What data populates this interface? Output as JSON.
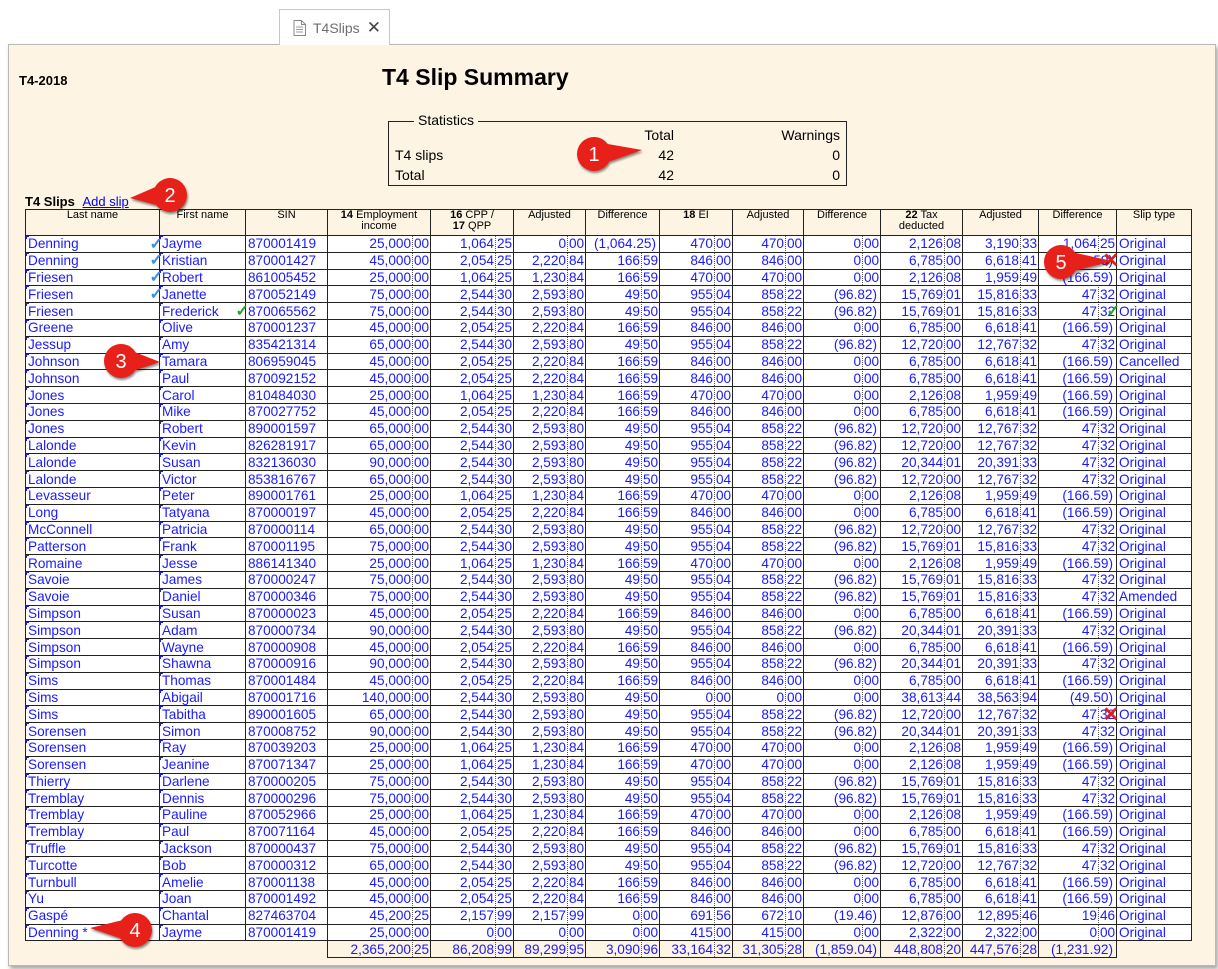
{
  "tab": {
    "label": "T4Slips",
    "close": "✕",
    "icon": "document-icon"
  },
  "year": "T4-2018",
  "title": "T4 Slip Summary",
  "stats": {
    "legend": "Statistics",
    "headers": [
      "",
      "Total",
      "Warnings"
    ],
    "rows": [
      [
        "T4 slips",
        "42",
        "0"
      ],
      [
        "Total",
        "42",
        "0"
      ]
    ]
  },
  "slips_heading": "T4 Slips",
  "add_slip": "Add slip",
  "columns": [
    {
      "label": "Last name"
    },
    {
      "label": "First name"
    },
    {
      "label": "SIN"
    },
    {
      "num": "14",
      "label": "Employment income"
    },
    {
      "num": "16",
      "label": "CPP /",
      "num2": "17",
      "label2": "QPP"
    },
    {
      "label": "Adjusted"
    },
    {
      "label": "Difference"
    },
    {
      "num": "18",
      "label": "EI"
    },
    {
      "label": "Adjusted"
    },
    {
      "label": "Difference"
    },
    {
      "num": "22",
      "label": "Tax deducted"
    },
    {
      "label": "Adjusted"
    },
    {
      "label": "Difference"
    },
    {
      "label": "Slip type"
    }
  ],
  "rows": [
    [
      "Denning",
      "Jayme",
      "870001419",
      "25,000.00",
      "1,064.25",
      "0.00",
      "(1,064.25)",
      "470.00",
      "470.00",
      "0.00",
      "2,126.08",
      "3,190.33",
      "1,064.25",
      "Original"
    ],
    [
      "Denning",
      "Kristian",
      "870001427",
      "45,000.00",
      "2,054.25",
      "2,220.84",
      "166.59",
      "846.00",
      "846.00",
      "0.00",
      "6,785.00",
      "6,618.41",
      "(166.59)",
      "Original"
    ],
    [
      "Friesen",
      "Robert",
      "861005452",
      "25,000.00",
      "1,064.25",
      "1,230.84",
      "166.59",
      "470.00",
      "470.00",
      "0.00",
      "2,126.08",
      "1,959.49",
      "(166.59)",
      "Original"
    ],
    [
      "Friesen",
      "Janette",
      "870052149",
      "75,000.00",
      "2,544.30",
      "2,593.80",
      "49.50",
      "955.04",
      "858.22",
      "(96.82)",
      "15,769.01",
      "15,816.33",
      "47.32",
      "Original"
    ],
    [
      "Friesen",
      "Frederick",
      "870065562",
      "75,000.00",
      "2,544.30",
      "2,593.80",
      "49.50",
      "955.04",
      "858.22",
      "(96.82)",
      "15,769.01",
      "15,816.33",
      "47.32",
      "Original"
    ],
    [
      "Greene",
      "Olive",
      "870001237",
      "45,000.00",
      "2,054.25",
      "2,220.84",
      "166.59",
      "846.00",
      "846.00",
      "0.00",
      "6,785.00",
      "6,618.41",
      "(166.59)",
      "Original"
    ],
    [
      "Jessup",
      "Amy",
      "835421314",
      "65,000.00",
      "2,544.30",
      "2,593.80",
      "49.50",
      "955.04",
      "858.22",
      "(96.82)",
      "12,720.00",
      "12,767.32",
      "47.32",
      "Original"
    ],
    [
      "Johnson",
      "Tamara",
      "806959045",
      "45,000.00",
      "2,054.25",
      "2,220.84",
      "166.59",
      "846.00",
      "846.00",
      "0.00",
      "6,785.00",
      "6,618.41",
      "(166.59)",
      "Cancelled"
    ],
    [
      "Johnson",
      "Paul",
      "870092152",
      "45,000.00",
      "2,054.25",
      "2,220.84",
      "166.59",
      "846.00",
      "846.00",
      "0.00",
      "6,785.00",
      "6,618.41",
      "(166.59)",
      "Original"
    ],
    [
      "Jones",
      "Carol",
      "810484030",
      "25,000.00",
      "1,064.25",
      "1,230.84",
      "166.59",
      "470.00",
      "470.00",
      "0.00",
      "2,126.08",
      "1,959.49",
      "(166.59)",
      "Original"
    ],
    [
      "Jones",
      "Mike",
      "870027752",
      "45,000.00",
      "2,054.25",
      "2,220.84",
      "166.59",
      "846.00",
      "846.00",
      "0.00",
      "6,785.00",
      "6,618.41",
      "(166.59)",
      "Original"
    ],
    [
      "Jones",
      "Robert",
      "890001597",
      "65,000.00",
      "2,544.30",
      "2,593.80",
      "49.50",
      "955.04",
      "858.22",
      "(96.82)",
      "12,720.00",
      "12,767.32",
      "47.32",
      "Original"
    ],
    [
      "Lalonde",
      "Kevin",
      "826281917",
      "65,000.00",
      "2,544.30",
      "2,593.80",
      "49.50",
      "955.04",
      "858.22",
      "(96.82)",
      "12,720.00",
      "12,767.32",
      "47.32",
      "Original"
    ],
    [
      "Lalonde",
      "Susan",
      "832136030",
      "90,000.00",
      "2,544.30",
      "2,593.80",
      "49.50",
      "955.04",
      "858.22",
      "(96.82)",
      "20,344.01",
      "20,391.33",
      "47.32",
      "Original"
    ],
    [
      "Lalonde",
      "Victor",
      "853816767",
      "65,000.00",
      "2,544.30",
      "2,593.80",
      "49.50",
      "955.04",
      "858.22",
      "(96.82)",
      "12,720.00",
      "12,767.32",
      "47.32",
      "Original"
    ],
    [
      "Levasseur",
      "Peter",
      "890001761",
      "25,000.00",
      "1,064.25",
      "1,230.84",
      "166.59",
      "470.00",
      "470.00",
      "0.00",
      "2,126.08",
      "1,959.49",
      "(166.59)",
      "Original"
    ],
    [
      "Long",
      "Tatyana",
      "870000197",
      "45,000.00",
      "2,054.25",
      "2,220.84",
      "166.59",
      "846.00",
      "846.00",
      "0.00",
      "6,785.00",
      "6,618.41",
      "(166.59)",
      "Original"
    ],
    [
      "McConnell",
      "Patricia",
      "870000114",
      "65,000.00",
      "2,544.30",
      "2,593.80",
      "49.50",
      "955.04",
      "858.22",
      "(96.82)",
      "12,720.00",
      "12,767.32",
      "47.32",
      "Original"
    ],
    [
      "Patterson",
      "Frank",
      "870001195",
      "75,000.00",
      "2,544.30",
      "2,593.80",
      "49.50",
      "955.04",
      "858.22",
      "(96.82)",
      "15,769.01",
      "15,816.33",
      "47.32",
      "Original"
    ],
    [
      "Romaine",
      "Jesse",
      "886141340",
      "25,000.00",
      "1,064.25",
      "1,230.84",
      "166.59",
      "470.00",
      "470.00",
      "0.00",
      "2,126.08",
      "1,959.49",
      "(166.59)",
      "Original"
    ],
    [
      "Savoie",
      "James",
      "870000247",
      "75,000.00",
      "2,544.30",
      "2,593.80",
      "49.50",
      "955.04",
      "858.22",
      "(96.82)",
      "15,769.01",
      "15,816.33",
      "47.32",
      "Original"
    ],
    [
      "Savoie",
      "Daniel",
      "870000346",
      "75,000.00",
      "2,544.30",
      "2,593.80",
      "49.50",
      "955.04",
      "858.22",
      "(96.82)",
      "15,769.01",
      "15,816.33",
      "47.32",
      "Amended"
    ],
    [
      "Simpson",
      "Susan",
      "870000023",
      "45,000.00",
      "2,054.25",
      "2,220.84",
      "166.59",
      "846.00",
      "846.00",
      "0.00",
      "6,785.00",
      "6,618.41",
      "(166.59)",
      "Original"
    ],
    [
      "Simpson",
      "Adam",
      "870000734",
      "90,000.00",
      "2,544.30",
      "2,593.80",
      "49.50",
      "955.04",
      "858.22",
      "(96.82)",
      "20,344.01",
      "20,391.33",
      "47.32",
      "Original"
    ],
    [
      "Simpson",
      "Wayne",
      "870000908",
      "45,000.00",
      "2,054.25",
      "2,220.84",
      "166.59",
      "846.00",
      "846.00",
      "0.00",
      "6,785.00",
      "6,618.41",
      "(166.59)",
      "Original"
    ],
    [
      "Simpson",
      "Shawna",
      "870000916",
      "90,000.00",
      "2,544.30",
      "2,593.80",
      "49.50",
      "955.04",
      "858.22",
      "(96.82)",
      "20,344.01",
      "20,391.33",
      "47.32",
      "Original"
    ],
    [
      "Sims",
      "Thomas",
      "870001484",
      "45,000.00",
      "2,054.25",
      "2,220.84",
      "166.59",
      "846.00",
      "846.00",
      "0.00",
      "6,785.00",
      "6,618.41",
      "(166.59)",
      "Original"
    ],
    [
      "Sims",
      "Abigail",
      "870001716",
      "140,000.00",
      "2,544.30",
      "2,593.80",
      "49.50",
      "0.00",
      "0.00",
      "0.00",
      "38,613.44",
      "38,563.94",
      "(49.50)",
      "Original"
    ],
    [
      "Sims",
      "Tabitha",
      "890001605",
      "65,000.00",
      "2,544.30",
      "2,593.80",
      "49.50",
      "955.04",
      "858.22",
      "(96.82)",
      "12,720.00",
      "12,767.32",
      "47.32",
      "Original"
    ],
    [
      "Sorensen",
      "Simon",
      "870008752",
      "90,000.00",
      "2,544.30",
      "2,593.80",
      "49.50",
      "955.04",
      "858.22",
      "(96.82)",
      "20,344.01",
      "20,391.33",
      "47.32",
      "Original"
    ],
    [
      "Sorensen",
      "Ray",
      "870039203",
      "25,000.00",
      "1,064.25",
      "1,230.84",
      "166.59",
      "470.00",
      "470.00",
      "0.00",
      "2,126.08",
      "1,959.49",
      "(166.59)",
      "Original"
    ],
    [
      "Sorensen",
      "Jeanine",
      "870071347",
      "25,000.00",
      "1,064.25",
      "1,230.84",
      "166.59",
      "470.00",
      "470.00",
      "0.00",
      "2,126.08",
      "1,959.49",
      "(166.59)",
      "Original"
    ],
    [
      "Thierry",
      "Darlene",
      "870000205",
      "75,000.00",
      "2,544.30",
      "2,593.80",
      "49.50",
      "955.04",
      "858.22",
      "(96.82)",
      "15,769.01",
      "15,816.33",
      "47.32",
      "Original"
    ],
    [
      "Tremblay",
      "Dennis",
      "870000296",
      "75,000.00",
      "2,544.30",
      "2,593.80",
      "49.50",
      "955.04",
      "858.22",
      "(96.82)",
      "15,769.01",
      "15,816.33",
      "47.32",
      "Original"
    ],
    [
      "Tremblay",
      "Pauline",
      "870052966",
      "25,000.00",
      "1,064.25",
      "1,230.84",
      "166.59",
      "470.00",
      "470.00",
      "0.00",
      "2,126.08",
      "1,959.49",
      "(166.59)",
      "Original"
    ],
    [
      "Tremblay",
      "Paul",
      "870071164",
      "45,000.00",
      "2,054.25",
      "2,220.84",
      "166.59",
      "846.00",
      "846.00",
      "0.00",
      "6,785.00",
      "6,618.41",
      "(166.59)",
      "Original"
    ],
    [
      "Truffle",
      "Jackson",
      "870000437",
      "75,000.00",
      "2,544.30",
      "2,593.80",
      "49.50",
      "955.04",
      "858.22",
      "(96.82)",
      "15,769.01",
      "15,816.33",
      "47.32",
      "Original"
    ],
    [
      "Turcotte",
      "Bob",
      "870000312",
      "65,000.00",
      "2,544.30",
      "2,593.80",
      "49.50",
      "955.04",
      "858.22",
      "(96.82)",
      "12,720.00",
      "12,767.32",
      "47.32",
      "Original"
    ],
    [
      "Turnbull",
      "Amelie",
      "870001138",
      "45,000.00",
      "2,054.25",
      "2,220.84",
      "166.59",
      "846.00",
      "846.00",
      "0.00",
      "6,785.00",
      "6,618.41",
      "(166.59)",
      "Original"
    ],
    [
      "Yu",
      "Joan",
      "870001492",
      "45,000.00",
      "2,054.25",
      "2,220.84",
      "166.59",
      "846.00",
      "846.00",
      "0.00",
      "6,785.00",
      "6,618.41",
      "(166.59)",
      "Original"
    ],
    [
      "Gaspé",
      "Chantal",
      "827463704",
      "45,200.25",
      "2,157.99",
      "2,157.99",
      "0.00",
      "691.56",
      "672.10",
      "(19.46)",
      "12,876.00",
      "12,895.46",
      "19.46",
      "Original"
    ],
    [
      "Denning *",
      "Jayme",
      "870001419",
      "25,000.00",
      "0.00",
      "0.00",
      "0.00",
      "415.00",
      "415.00",
      "0.00",
      "2,322.00",
      "2,322.00",
      "0.00",
      "Original"
    ]
  ],
  "totals": [
    "",
    "",
    "",
    "2,365,200.25",
    "86,208.99",
    "89,299.95",
    "3,090.96",
    "33,164.32",
    "31,305.28",
    "(1,859.04)",
    "448,808.20",
    "447,576.28",
    "(1,231.92)",
    ""
  ],
  "marks": [
    {
      "row": 0,
      "col": 0,
      "type": "check",
      "color": "#3a8ee6"
    },
    {
      "row": 1,
      "col": 0,
      "type": "check",
      "color": "#3a8ee6"
    },
    {
      "row": 2,
      "col": 0,
      "type": "check",
      "color": "#3a8ee6"
    },
    {
      "row": 3,
      "col": 0,
      "type": "check",
      "color": "#3a8ee6"
    },
    {
      "row": 4,
      "col": 1,
      "type": "check",
      "color": "#2aa42a"
    },
    {
      "row": 4,
      "col": 12,
      "type": "check",
      "color": "#2aa42a"
    },
    {
      "row": 1,
      "col": 12,
      "type": "cross",
      "color": "#e0201a"
    },
    {
      "row": 28,
      "col": 12,
      "type": "cross",
      "color": "#e0201a"
    }
  ],
  "callouts": [
    {
      "label": "1",
      "color": "#e8201a"
    },
    {
      "label": "2",
      "color": "#e8201a"
    },
    {
      "label": "3",
      "color": "#e8201a"
    },
    {
      "label": "4",
      "color": "#e8201a"
    },
    {
      "label": "5",
      "color": "#e8201a"
    }
  ]
}
